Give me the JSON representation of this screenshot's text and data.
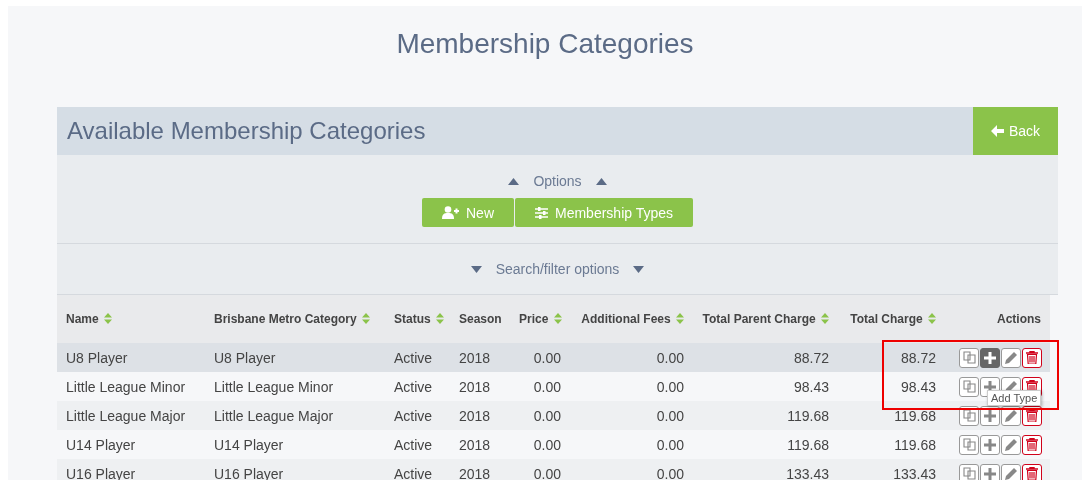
{
  "page_title": "Membership Categories",
  "card": {
    "title": "Available Membership Categories",
    "back_button": "Back"
  },
  "options": {
    "label": "Options",
    "expanded": true,
    "buttons": [
      {
        "kind": "new",
        "label": "New"
      },
      {
        "kind": "types",
        "label": "Membership Types"
      }
    ]
  },
  "search": {
    "label": "Search/filter options",
    "expanded": false
  },
  "table": {
    "columns": [
      {
        "label": "Name",
        "kind": "text",
        "sortable": true
      },
      {
        "label": "Brisbane Metro Category",
        "kind": "text",
        "sortable": true
      },
      {
        "label": "Status",
        "kind": "text",
        "sortable": true
      },
      {
        "label": "Season",
        "kind": "text",
        "sortable": false
      },
      {
        "label": "Price",
        "kind": "number",
        "sortable": true
      },
      {
        "label": "Additional Fees",
        "kind": "number",
        "sortable": true
      },
      {
        "label": "Total Parent Charge",
        "kind": "number",
        "sortable": true
      },
      {
        "label": "Total Charge",
        "kind": "number",
        "sortable": true
      },
      {
        "label": "Actions",
        "kind": "actions",
        "sortable": false
      }
    ],
    "rows": [
      {
        "highlighted": true,
        "cells": [
          "U8 Player",
          "U8 Player",
          "Active",
          "2018",
          "0.00",
          "0.00",
          "88.72",
          "88.72"
        ],
        "actions": [
          {
            "kind": "copy",
            "active": false
          },
          {
            "kind": "add",
            "active": true
          },
          {
            "kind": "edit",
            "active": false
          },
          {
            "kind": "delete",
            "active": false
          }
        ]
      },
      {
        "highlighted": false,
        "cells": [
          "Little League Minor",
          "Little League Minor",
          "Active",
          "2018",
          "0.00",
          "0.00",
          "98.43",
          "98.43"
        ],
        "actions": [
          {
            "kind": "copy",
            "active": false
          },
          {
            "kind": "add",
            "active": false
          },
          {
            "kind": "edit",
            "active": false
          },
          {
            "kind": "delete",
            "active": false
          }
        ]
      },
      {
        "highlighted": false,
        "cells": [
          "Little League Major",
          "Little League Major",
          "Active",
          "2018",
          "0.00",
          "0.00",
          "119.68",
          "119.68"
        ],
        "actions": [
          {
            "kind": "copy",
            "active": false
          },
          {
            "kind": "add",
            "active": false
          },
          {
            "kind": "edit",
            "active": false
          },
          {
            "kind": "delete",
            "active": false
          }
        ]
      },
      {
        "highlighted": false,
        "cells": [
          "U14 Player",
          "U14 Player",
          "Active",
          "2018",
          "0.00",
          "0.00",
          "119.68",
          "119.68"
        ],
        "actions": [
          {
            "kind": "copy",
            "active": false
          },
          {
            "kind": "add",
            "active": false
          },
          {
            "kind": "edit",
            "active": false
          },
          {
            "kind": "delete",
            "active": false
          }
        ]
      },
      {
        "highlighted": false,
        "cells": [
          "U16 Player",
          "U16 Player",
          "Active",
          "2018",
          "0.00",
          "0.00",
          "133.43",
          "133.43"
        ],
        "actions": [
          {
            "kind": "copy",
            "active": false
          },
          {
            "kind": "add",
            "active": false
          },
          {
            "kind": "edit",
            "active": false
          },
          {
            "kind": "delete",
            "active": false
          }
        ]
      }
    ]
  },
  "tooltip": {
    "text": "Add Type"
  }
}
